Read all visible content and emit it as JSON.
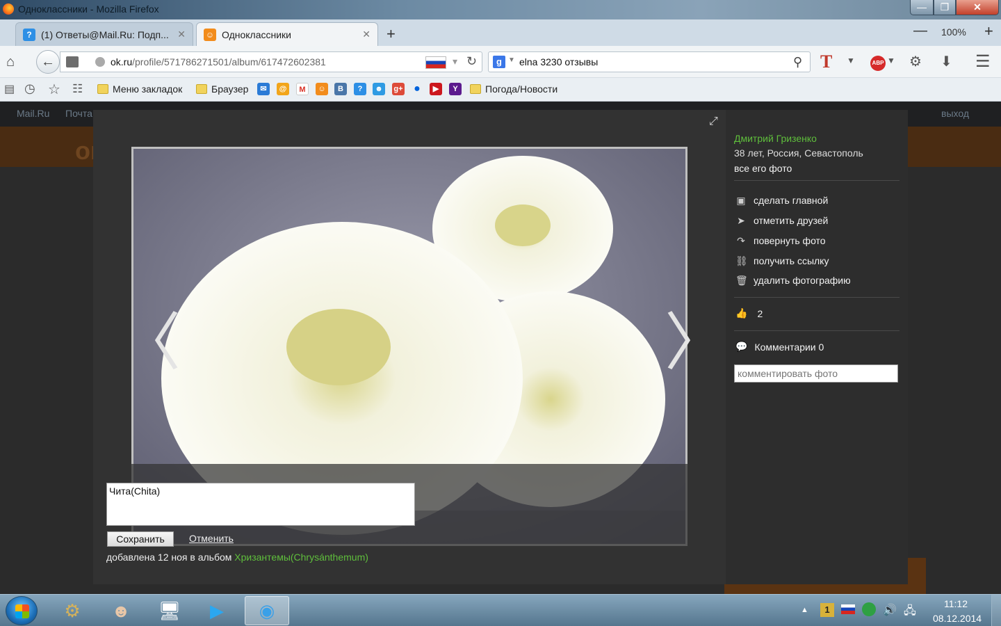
{
  "window": {
    "title": "Одноклассники - Mozilla Firefox",
    "buttons": {
      "minimize": "—",
      "maximize": "❐",
      "close": "✕"
    }
  },
  "tabs": [
    {
      "label": "(1) Ответы@Mail.Ru: Подп...",
      "favicon": "?",
      "close": "✕"
    },
    {
      "label": "Одноклассники",
      "favicon": "ok",
      "close": "✕"
    }
  ],
  "newtab": "+",
  "zoom": {
    "minus": "—",
    "value": "100%",
    "plus": "+"
  },
  "navbar": {
    "url_domain": "ok.ru",
    "url_path": "/profile/571786271501/album/617472602381",
    "search_engine": "g",
    "search_text": "elna 3230 отзывы"
  },
  "bookmarks": [
    {
      "label": "Меню закладок"
    },
    {
      "label": "Браузер"
    },
    {
      "label": "Погода/Новости"
    }
  ],
  "page_behind": {
    "mailru": "Mail.Ru",
    "pochta": "Почта",
    "exit": "выход",
    "logo": "ок"
  },
  "modal": {
    "caption_value": "Чита(Chita)",
    "save_label": "Сохранить",
    "cancel_label": "Отменить",
    "added_text": "добавлена 12 ноя в альбом ",
    "album_name": "Хризантемы(Chrysánthemum)",
    "owner_name": "Дмитрий Гризенко",
    "owner_info": "38 лет, Россия, Севастополь",
    "all_photos": "все его фото",
    "actions": {
      "make_main": "сделать главной",
      "tag_friends": "отметить друзей",
      "rotate": "повернуть фото",
      "get_link": "получить ссылку",
      "delete": "удалить фотографию"
    },
    "likes_count": "2",
    "comments_label": "Комментарии 0",
    "comment_placeholder": "комментировать фото"
  },
  "taskbar": {
    "time": "11:12",
    "date": "08.12.2014"
  },
  "colors": {
    "accent_green": "#5fbf3c",
    "modal_bg": "#323232",
    "ok_orange": "#f28c1c"
  }
}
